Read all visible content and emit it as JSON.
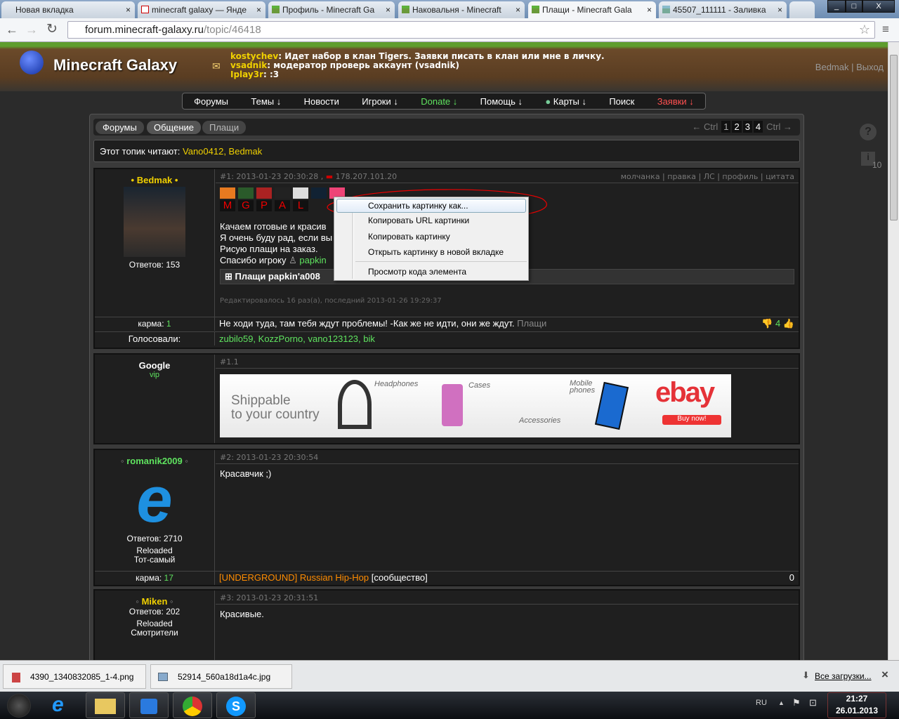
{
  "browser": {
    "tabs": [
      {
        "title": "Новая вкладка"
      },
      {
        "title": "minecraft galaxy — Янде"
      },
      {
        "title": "Профиль - Minecraft Ga"
      },
      {
        "title": "Наковальня - Minecraft"
      },
      {
        "title": "Плащи - Minecraft Gala"
      },
      {
        "title": "45507_111111 - Заливка"
      }
    ],
    "url_host": "forum.minecraft-galaxy.ru",
    "url_path": "/topic/46418",
    "close": "×",
    "min": "_",
    "max": "□",
    "winclose": "X"
  },
  "site": {
    "title": "Minecraft Galaxy",
    "user_links": "Bedmak | Выход",
    "shouts": [
      {
        "name": "kostychev",
        "text": ": Идет набор в клан Tigers. Заявки писать в клан или мне в личку."
      },
      {
        "name": "vsadnik",
        "text": ": модератор проверь аккаунт (vsadnik)"
      },
      {
        "name": "Iplay3r",
        "text": ": :3"
      }
    ],
    "nav": [
      "Форумы",
      "Темы ↓",
      "Новости",
      "Игроки ↓",
      "Donate ↓",
      "Помощь ↓",
      "Карты ↓",
      "Поиск",
      "Заявки ↓"
    ],
    "colors": {
      "donate": "#5fe35f",
      "apps": "#ff5050",
      "accent": "#f0d000"
    }
  },
  "breadcrumb": [
    "Форумы",
    "Общение",
    "Плащи"
  ],
  "pager": {
    "prev": "← Ctrl",
    "pages": [
      "1",
      "2",
      "3",
      "4"
    ],
    "next": "Ctrl →"
  },
  "readers": {
    "label": "Этот топик читают: ",
    "users": "Vano0412, Bedmak"
  },
  "posts": [
    {
      "user": "Bedmak",
      "replies": "Ответов: 153",
      "meta": "#1: 2013-01-23 20:30:28 , ",
      "ip": "178.207.101.20",
      "actions": "молчанка | правка | ЛС | профиль | цитата",
      "lines": [
        "Качаем готовые и красив",
        "Я очень буду рад, если вы",
        "Рисую плащи на заказ."
      ],
      "thanks": "Спасибо игроку ",
      "thanks_user": "papkin",
      "spoiler": "Плащи papkin'a008",
      "letters": [
        "M",
        "G",
        "P",
        "A",
        "L"
      ],
      "edited": "Редактировалось 16 раз(а), последний 2013-01-26 19:29:37",
      "karma_label": "карма: ",
      "karma": "1",
      "signature": "Не ходи туда, там тебя ждут проблемы! -Как же не идти, они же ждут.",
      "sig_link": "Плащи",
      "votes": "4",
      "voted_label": "Голосовали:",
      "voters": "zubilo59, KozzPorno, vano123123, bik"
    },
    {
      "user": "Google",
      "rank": "vip",
      "meta": "#1.1",
      "ad": {
        "l1": "Shippable",
        "l2": "to your country",
        "headphones": "Headphones",
        "cases": "Cases",
        "accessories": "Accessories",
        "mobile": "Mobile phones",
        "ebay": "ebay",
        "buy": "Buy now!"
      }
    },
    {
      "user": "romanik2009",
      "replies": "Ответов: 2710",
      "status1": "Reloaded",
      "status2": "Тот-самый",
      "meta": "#2: 2013-01-23 20:30:54",
      "text": "Красавчик ;)",
      "karma_label": "карма: ",
      "karma": "17",
      "sig_link": "[UNDERGROUND] Russian Hip-Hop",
      "sig_text": " [сообщество]",
      "votes": "0"
    },
    {
      "user": "Miken",
      "replies": "Ответов: 202",
      "status1": "Reloaded",
      "status2": "Смотрители",
      "meta": "#3: 2013-01-23 20:31:51",
      "text": "Красивые."
    }
  ],
  "context_menu": [
    "Сохранить картинку как...",
    "Копировать URL картинки",
    "Копировать картинку",
    "Открыть картинку в новой вкладке",
    "Просмотр кода элемента"
  ],
  "side": {
    "help": "?",
    "info": "i",
    "count": "10"
  },
  "downloads": {
    "items": [
      "4390_1340832085_1-4.png",
      "52914_560a18d1a4c.jpg"
    ],
    "all": "Все загрузки...",
    "close": "×"
  },
  "taskbar": {
    "lang": "RU",
    "time": "21:27",
    "date": "26.01.2013"
  }
}
